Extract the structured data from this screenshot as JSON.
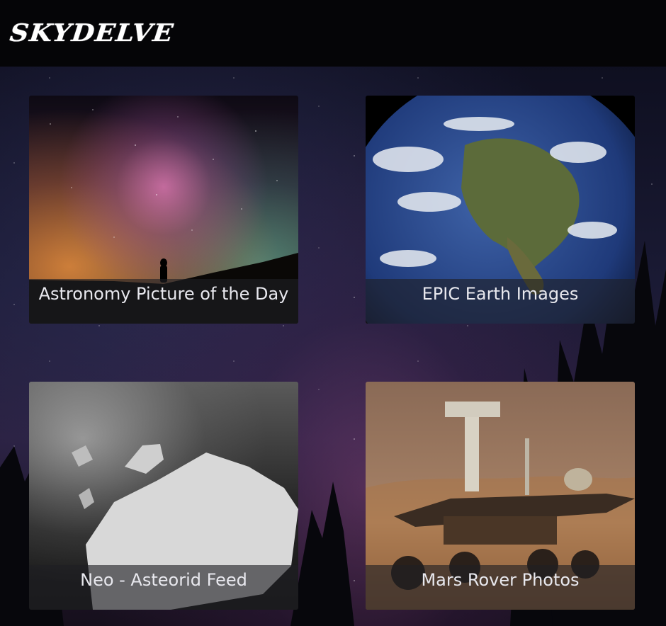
{
  "app": {
    "logo": "SKYDELVE"
  },
  "cards": [
    {
      "id": "apod",
      "title": "Astronomy Picture of the Day",
      "icon": "milky-way-photo"
    },
    {
      "id": "epic",
      "title": "EPIC Earth Images",
      "icon": "earth-photo"
    },
    {
      "id": "neo",
      "title": "Neo - Asteorid Feed",
      "icon": "asteroid-photo"
    },
    {
      "id": "mars",
      "title": "Mars Rover Photos",
      "icon": "mars-rover-photo"
    }
  ],
  "colors": {
    "header_bg": "#050507",
    "caption_bg": "rgba(30,30,36,0.62)",
    "caption_text": "#e8e8ee"
  }
}
